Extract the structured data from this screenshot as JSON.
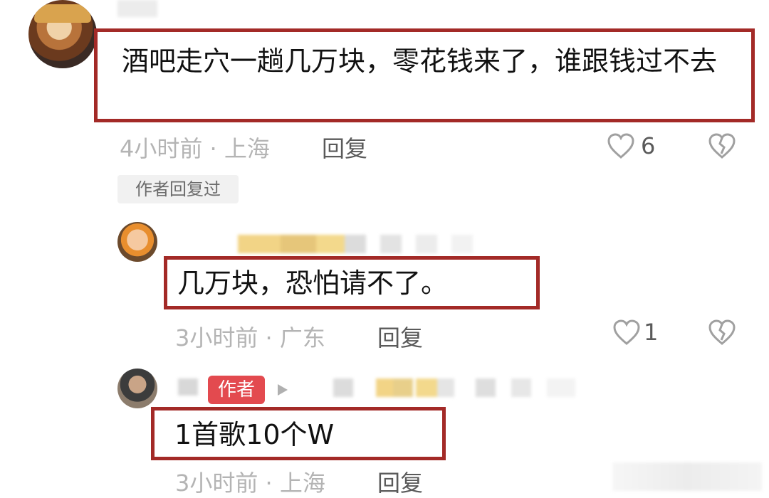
{
  "comments": [
    {
      "text": "酒吧走穴一趟几万块，零花钱来了，谁跟钱过不去",
      "time": "4小时前",
      "separator": "·",
      "location": "上海",
      "reply_label": "回复",
      "likes": "6",
      "author_replied_tag": "作者回复过",
      "replies": [
        {
          "text": "几万块，恐怕请不了。",
          "time": "3小时前",
          "separator": "·",
          "location": "广东",
          "reply_label": "回复",
          "likes": "1"
        },
        {
          "author_badge": "作者",
          "text": "1首歌10个W",
          "time": "3小时前",
          "separator": "·",
          "location": "上海",
          "reply_label": "回复"
        }
      ]
    }
  ],
  "colors": {
    "highlight_border": "#a32a27",
    "author_badge": "#e34a4f",
    "meta_text": "#b4b4b4"
  },
  "icons": {
    "like": "heart-outline-icon",
    "dislike": "broken-heart-icon",
    "play": "play-triangle-icon"
  }
}
